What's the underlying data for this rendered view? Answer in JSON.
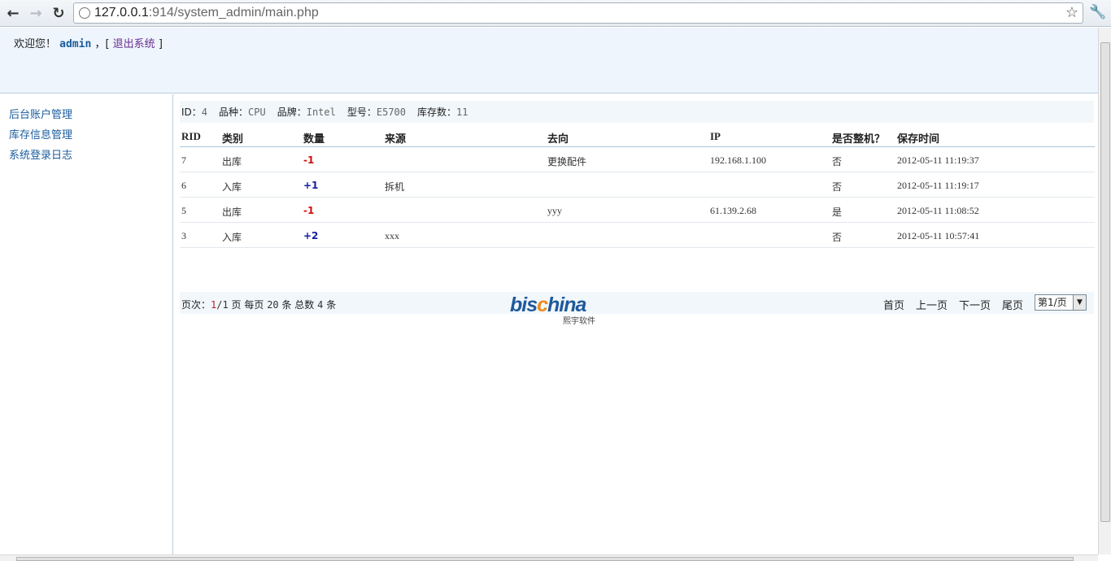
{
  "browser": {
    "url_host": "127.0.0.1",
    "url_rest": ":914/system_admin/main.php"
  },
  "header": {
    "welcome_prefix": "欢迎您！",
    "username": "admin",
    "separator": "，[",
    "logout_label": "退出系统",
    "closing": "]"
  },
  "sidebar": {
    "items": [
      {
        "label": "后台账户管理"
      },
      {
        "label": "库存信息管理"
      },
      {
        "label": "系统登录日志"
      }
    ]
  },
  "info": {
    "id_label": "ID：",
    "id_value": "4",
    "type_label": "品种：",
    "type_value": "CPU",
    "brand_label": "品牌：",
    "brand_value": "Intel",
    "model_label": "型号：",
    "model_value": "E5700",
    "stock_label": "库存数：",
    "stock_value": "11"
  },
  "table": {
    "headers": [
      "RID",
      "类别",
      "数量",
      "来源",
      "去向",
      "IP",
      "是否整机？",
      "保存时间"
    ],
    "rows": [
      {
        "rid": "7",
        "category": "出库",
        "qty": "-1",
        "source": "",
        "dest": "更换配件",
        "ip": "192.168.1.100",
        "whole": "否",
        "time": "2012-05-11 11:19:37"
      },
      {
        "rid": "6",
        "category": "入库",
        "qty": "+1",
        "source": "拆机",
        "dest": "",
        "ip": "",
        "whole": "否",
        "time": "2012-05-11 11:19:17"
      },
      {
        "rid": "5",
        "category": "出库",
        "qty": "-1",
        "source": "",
        "dest": "yyy",
        "ip": "61.139.2.68",
        "whole": "是",
        "time": "2012-05-11 11:08:52"
      },
      {
        "rid": "3",
        "category": "入库",
        "qty": "+2",
        "source": "xxx",
        "dest": "",
        "ip": "",
        "whole": "否",
        "time": "2012-05-11 10:57:41"
      }
    ]
  },
  "pager": {
    "label_page": "页次：",
    "current_page": "1",
    "slash": "/",
    "total_pages": "1",
    "label_per_page": "页 每页",
    "per_page": "20",
    "label_total": "条 总数",
    "total": "4",
    "label_unit": "条",
    "first": "首页",
    "prev": "上一页",
    "next": "下一页",
    "last": "尾页",
    "select_value": "第1/页"
  },
  "logo": {
    "text": "bischina",
    "subtitle": "熙宇软件"
  },
  "colors": {
    "accent": "#1a5c9e",
    "negative": "#d01010",
    "positive": "#1520a0"
  }
}
